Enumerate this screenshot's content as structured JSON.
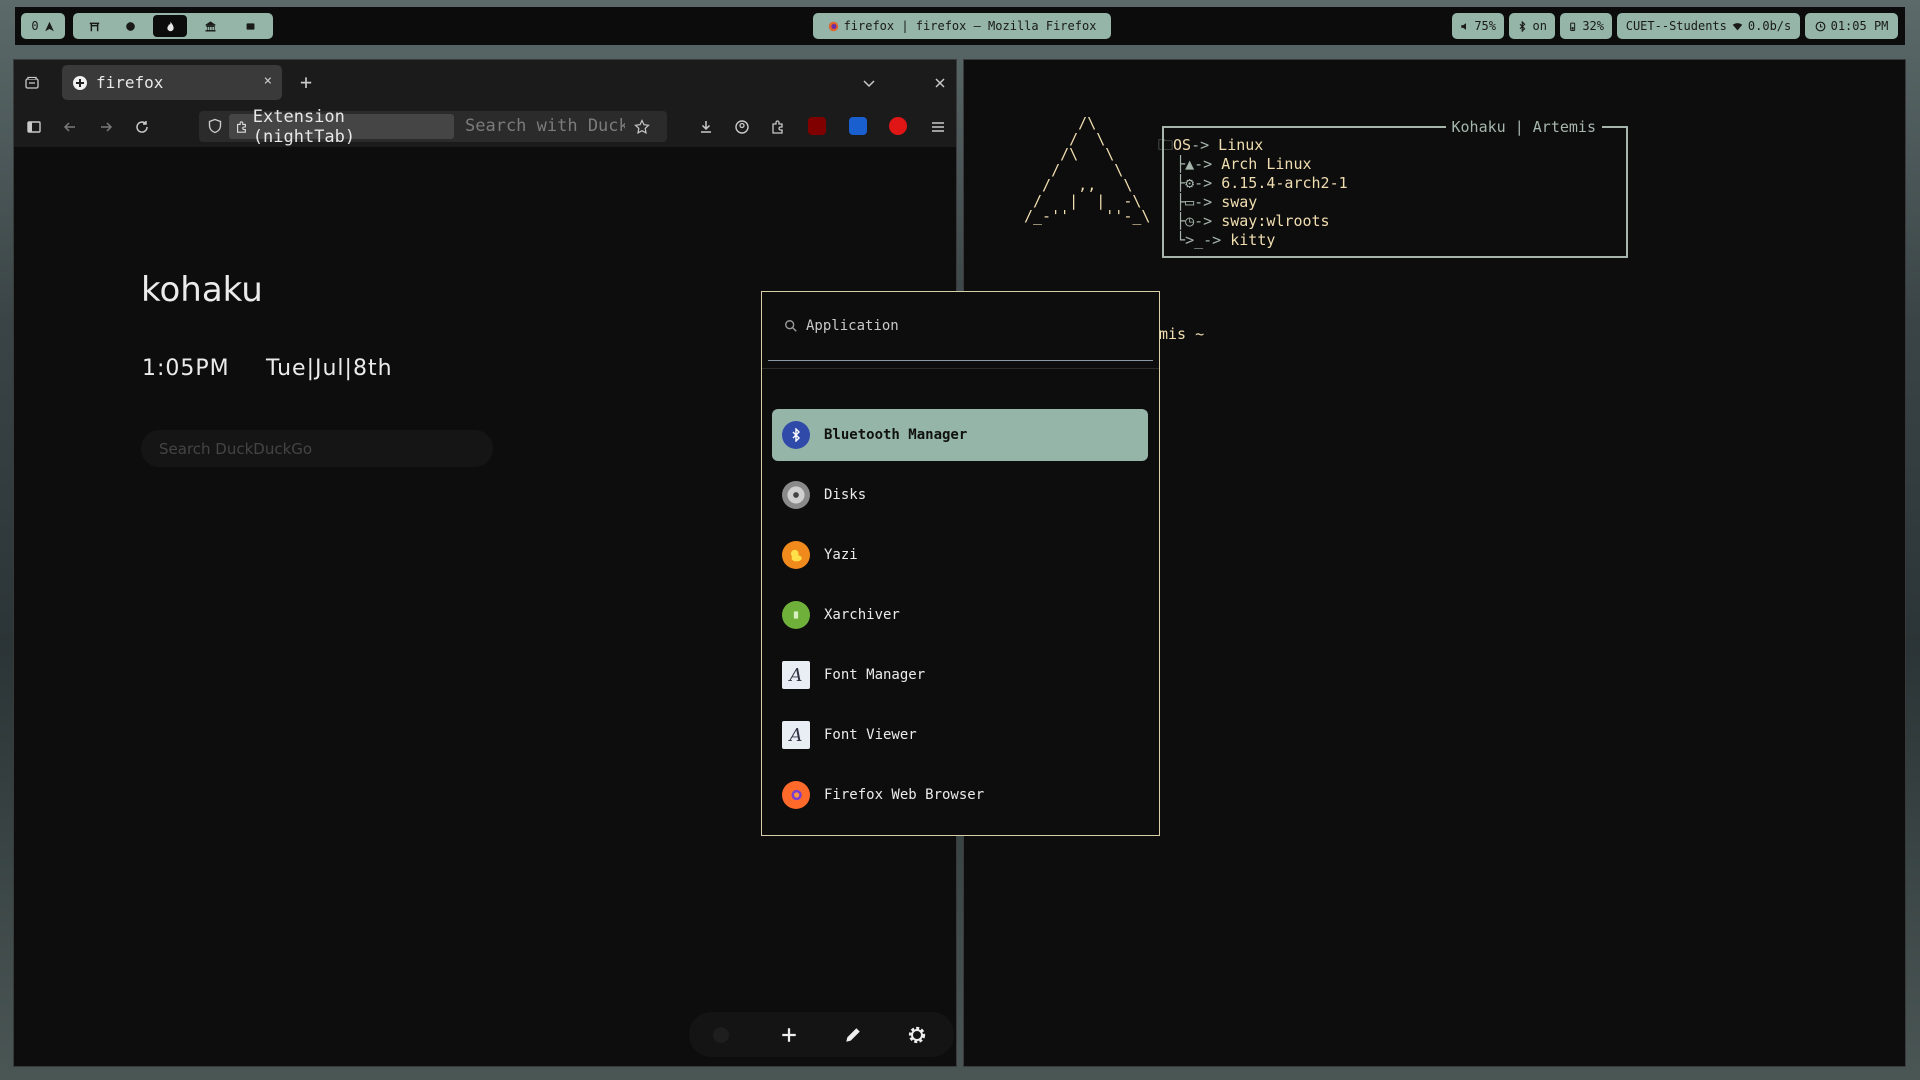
{
  "topbar": {
    "workspace_label": "0",
    "window_title": "firefox | firefox — Mozilla Firefox",
    "volume": "75%",
    "bluetooth": "on",
    "battery": "32%",
    "network": "CUET--Students",
    "net_speed": "0.0b/s",
    "clock": "01:05 PM"
  },
  "firefox": {
    "tab_label": "firefox",
    "tab_close": "×",
    "new_tab": "+",
    "url_chip": "Extension (nightTab)",
    "url_placeholder": "Search with DuckDuckGo",
    "page": {
      "name": "kohaku",
      "time": "1:05PM",
      "date": "Tue|Jul|8th",
      "search_placeholder": "Search DuckDuckGo"
    }
  },
  "terminal": {
    "fetch_title": "Kohaku | Artemis",
    "lines": [
      {
        "icon": "",
        "label": "OS",
        "value": "Linux"
      },
      {
        "icon": "",
        "label": "",
        "value": "Arch Linux"
      },
      {
        "icon": "",
        "label": "",
        "value": "6.15.4-arch2-1"
      },
      {
        "icon": "",
        "label": "",
        "value": "sway"
      },
      {
        "icon": "",
        "label": "",
        "value": "sway:wlroots"
      },
      {
        "icon": "",
        "label": "",
        "value": "kitty"
      }
    ],
    "prompt": "mis ~"
  },
  "launcher": {
    "placeholder": "Application",
    "items": [
      {
        "label": "Bluetooth Manager",
        "icon": "bluetooth-icon",
        "color": "#2f4aa8"
      },
      {
        "label": "Disks",
        "icon": "disk-icon",
        "color": "#8a8a8a"
      },
      {
        "label": "Yazi",
        "icon": "duck-icon",
        "color": "#f08a1c"
      },
      {
        "label": "Xarchiver",
        "icon": "archive-icon",
        "color": "#6fb03a"
      },
      {
        "label": "Font Manager",
        "icon": "font-icon",
        "color": "#e8eef4"
      },
      {
        "label": "Font Viewer",
        "icon": "font-icon",
        "color": "#e8eef4"
      },
      {
        "label": "Firefox Web Browser",
        "icon": "firefox-icon",
        "color": "#ff6a2a"
      }
    ]
  }
}
